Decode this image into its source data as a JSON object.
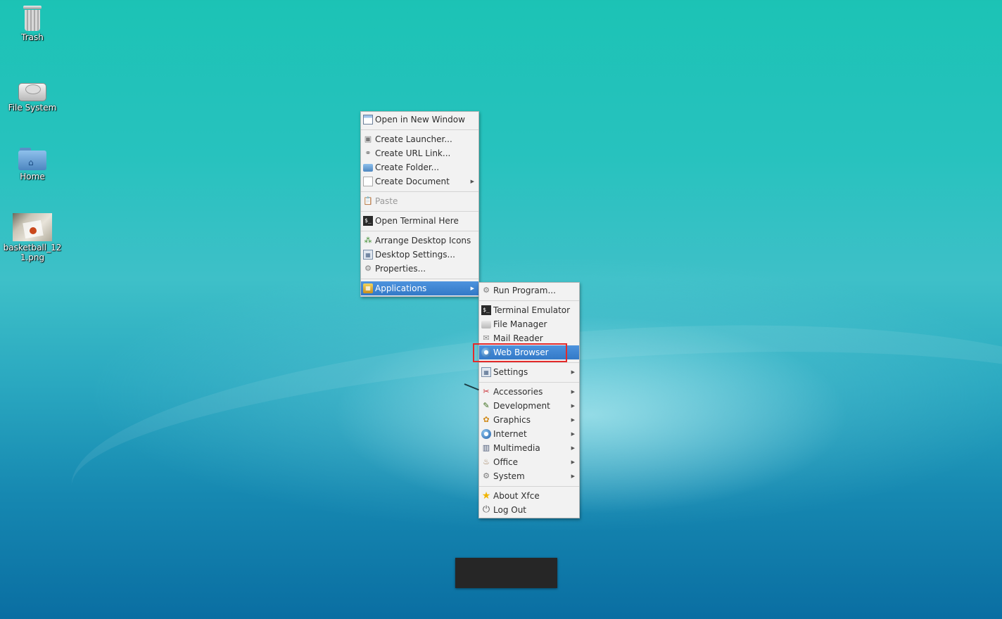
{
  "desktop": {
    "icons": [
      {
        "label": "Trash",
        "icon": "trash-icon"
      },
      {
        "label": "File System",
        "icon": "drive-icon"
      },
      {
        "label": "Home",
        "icon": "home-folder-icon"
      },
      {
        "label": "basketball_121.png",
        "icon": "image-thumbnail"
      }
    ]
  },
  "context_menu": {
    "items": [
      {
        "label": "Open in New Window"
      },
      {
        "label": "Create Launcher..."
      },
      {
        "label": "Create URL Link..."
      },
      {
        "label": "Create Folder..."
      },
      {
        "label": "Create Document",
        "submenu": true
      },
      {
        "label": "Paste",
        "disabled": true
      },
      {
        "label": "Open Terminal Here"
      },
      {
        "label": "Arrange Desktop Icons"
      },
      {
        "label": "Desktop Settings..."
      },
      {
        "label": "Properties..."
      },
      {
        "label": "Applications",
        "submenu": true,
        "selected": true
      }
    ]
  },
  "applications_menu": {
    "items": [
      {
        "label": "Run Program..."
      },
      {
        "label": "Terminal Emulator"
      },
      {
        "label": "File Manager"
      },
      {
        "label": "Mail Reader"
      },
      {
        "label": "Web Browser",
        "selected": true
      },
      {
        "label": "Settings",
        "submenu": true
      },
      {
        "label": "Accessories",
        "submenu": true
      },
      {
        "label": "Development",
        "submenu": true
      },
      {
        "label": "Graphics",
        "submenu": true
      },
      {
        "label": "Internet",
        "submenu": true
      },
      {
        "label": "Multimedia",
        "submenu": true
      },
      {
        "label": "Office",
        "submenu": true
      },
      {
        "label": "System",
        "submenu": true
      },
      {
        "label": "About Xfce"
      },
      {
        "label": "Log Out"
      }
    ]
  },
  "colors": {
    "selection": "#3d86d4",
    "highlight_box": "#e32b2b",
    "desktop_top": "#1cc3b5",
    "desktop_bottom": "#0a6ea2"
  }
}
